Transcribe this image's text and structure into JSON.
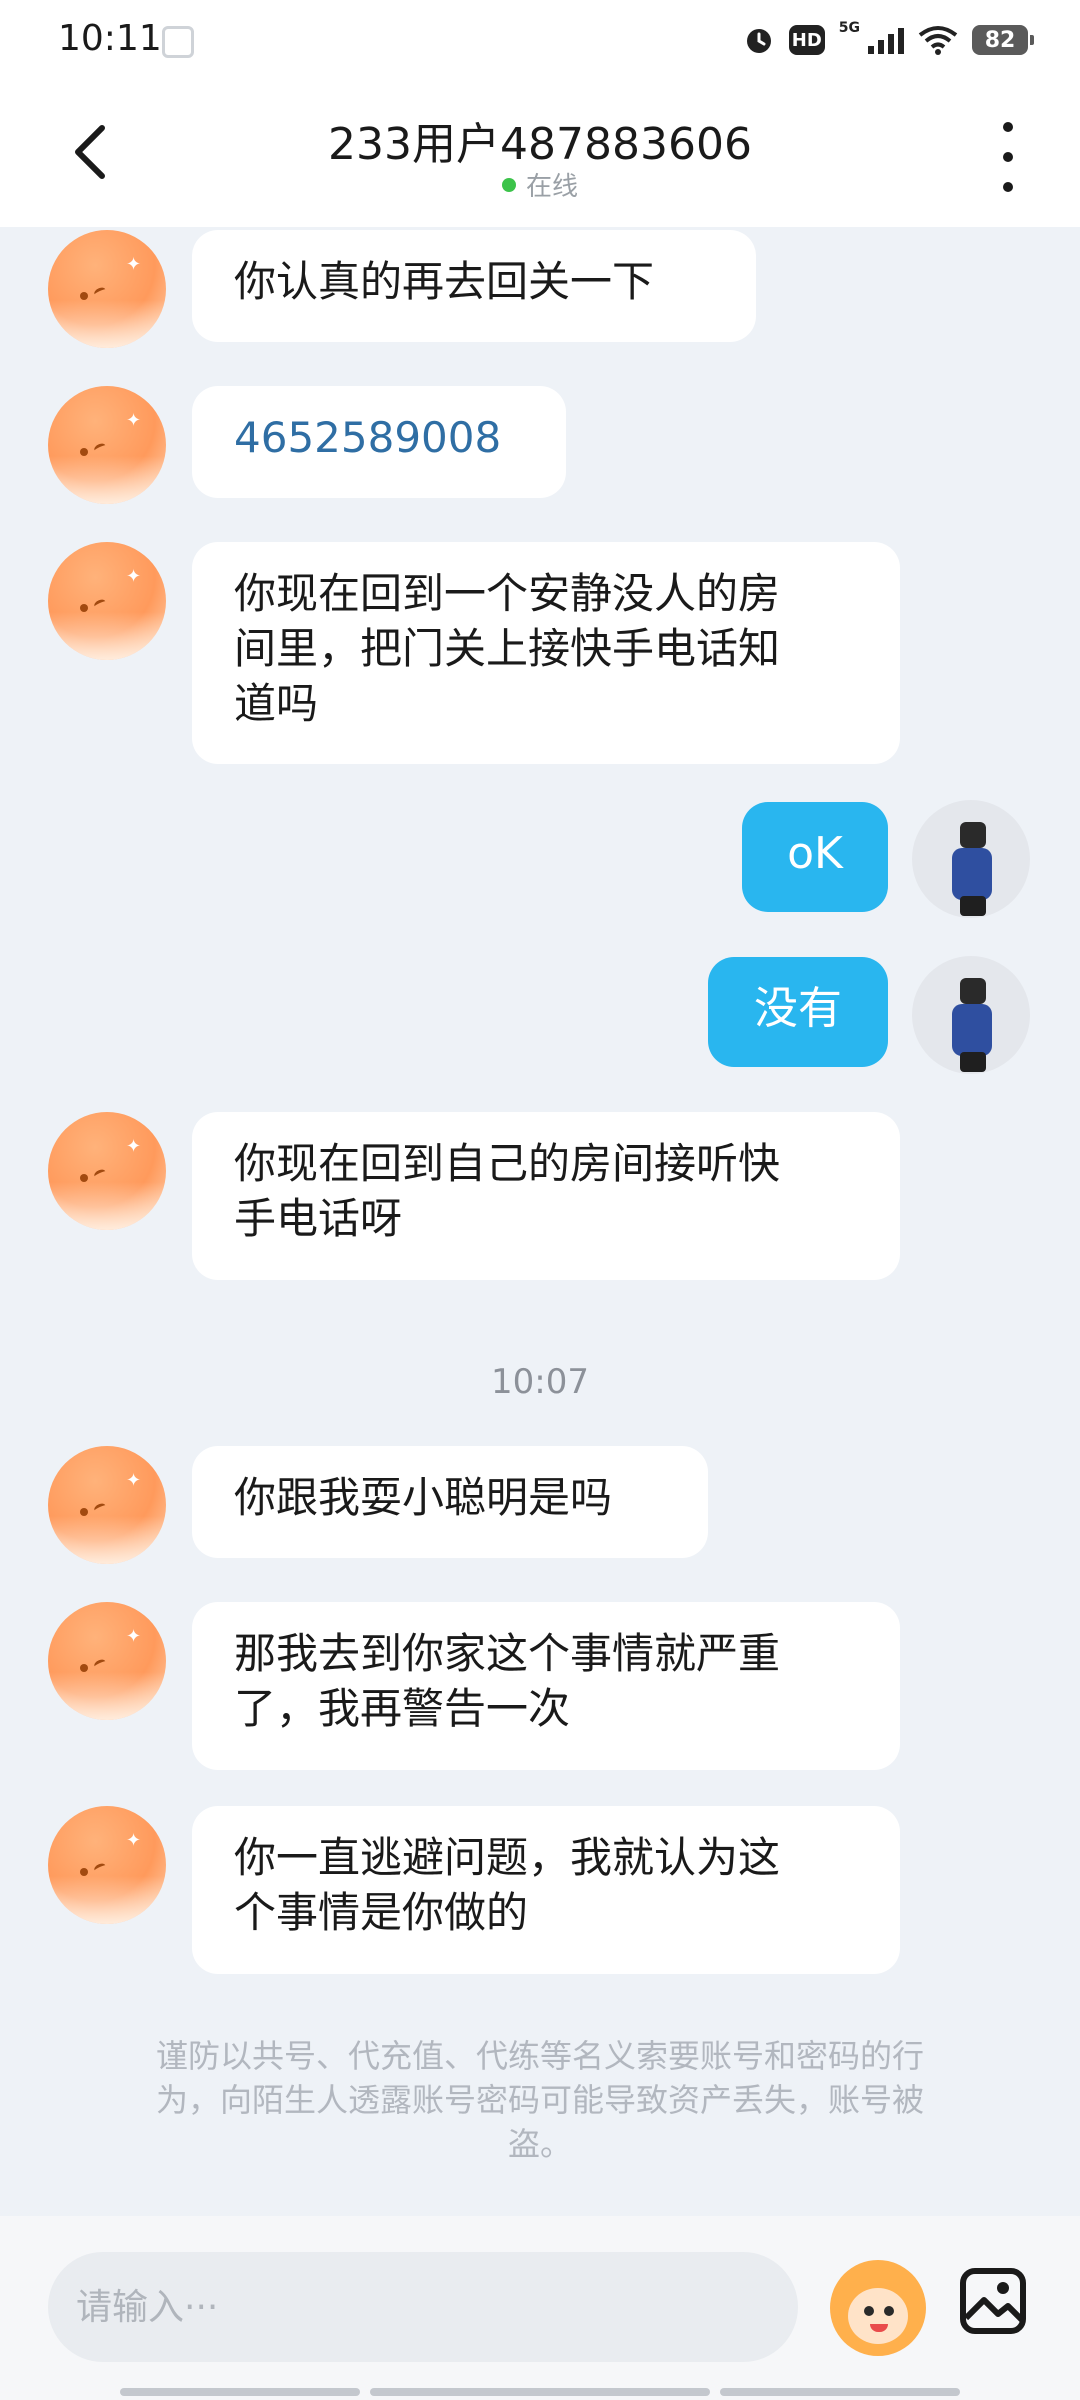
{
  "status_bar": {
    "time": "10:11",
    "network": "5G",
    "hd": "HD",
    "battery": "82"
  },
  "header": {
    "title": "233用户487883606",
    "status": "在线",
    "status_color": "#3cc34a"
  },
  "messages": [
    {
      "side": "in",
      "text": "你认真的再去回关一下"
    },
    {
      "side": "in",
      "text": "4652589008",
      "style": "link"
    },
    {
      "side": "in",
      "lines": [
        "你现在回到一个安静没人的房",
        "间里，把门关上接快手电话知",
        "道吗"
      ]
    },
    {
      "side": "out",
      "text": "oK"
    },
    {
      "side": "out",
      "text": "没有"
    },
    {
      "side": "in",
      "lines": [
        "你现在回到自己的房间接听快",
        "手电话呀"
      ]
    },
    {
      "side": "in",
      "text": "你跟我耍小聪明是吗"
    },
    {
      "side": "in",
      "lines": [
        "那我去到你家这个事情就严重",
        "了，我再警告一次"
      ]
    },
    {
      "side": "in",
      "lines": [
        "你一直逃避问题，我就认为这",
        "个事情是你做的"
      ]
    }
  ],
  "time_separator": "10:07",
  "warning": {
    "lines": [
      "谨防以共号、代充值、代练等名义索要账号和密码的行",
      "为，向陌生人透露账号密码可能导致资产丢失，账号被",
      "盗。"
    ]
  },
  "input": {
    "placeholder": "请输入···"
  },
  "colors": {
    "out_bubble": "#29b6ef",
    "link": "#2f6ea4",
    "background": "#eef2f7"
  }
}
